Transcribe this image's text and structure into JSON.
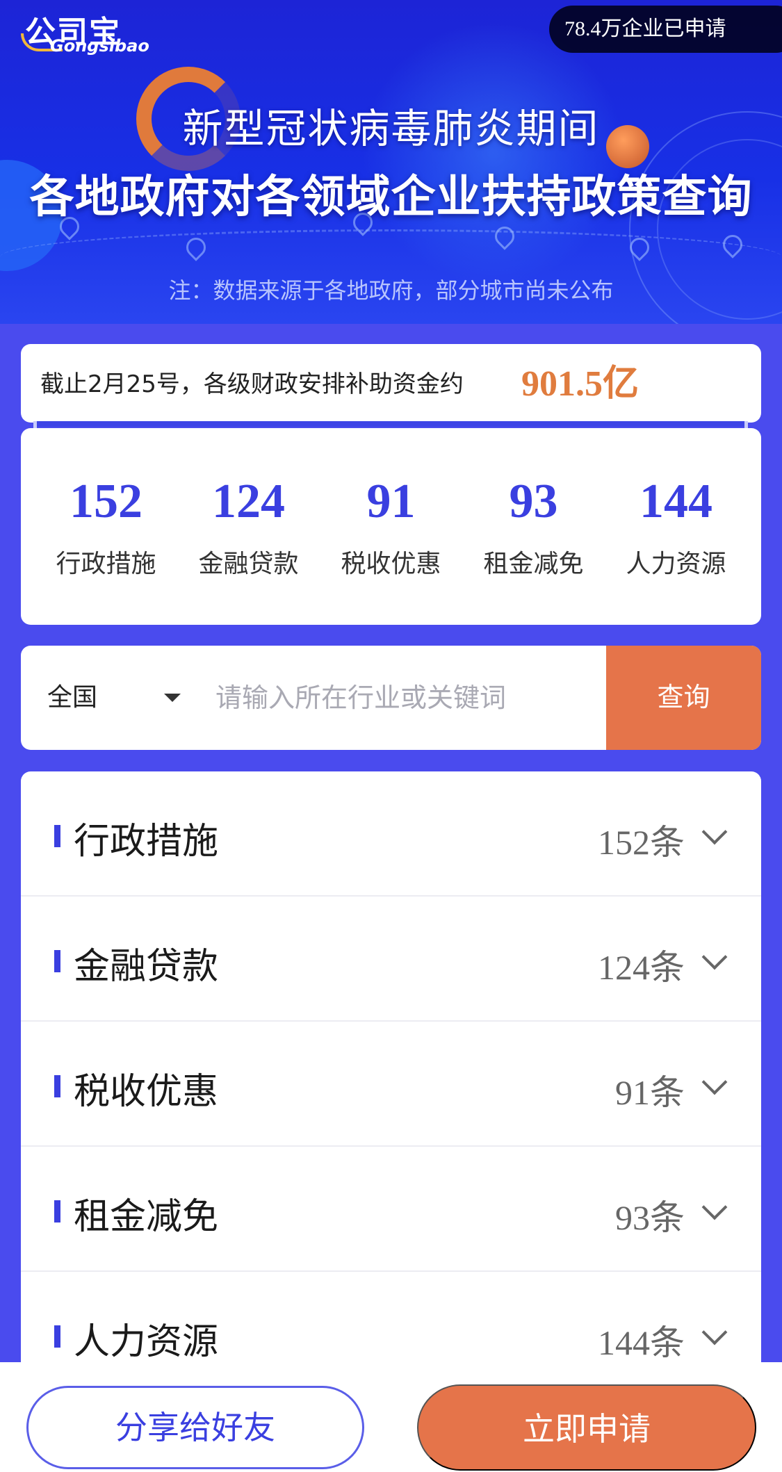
{
  "header": {
    "logo_cn": "公司宝",
    "logo_en": "Gongsibao",
    "applied_badge": "78.4万企业已申请",
    "title_line1": "新型冠状病毒肺炎期间",
    "title_line2": "各地政府对各领域企业扶持政策查询",
    "note": "注：数据来源于各地政府，部分城市尚未公布"
  },
  "funding": {
    "text": "截止2月25号，各级财政安排补助资金约",
    "amount": "901.5亿",
    "accent_color": "#e07c3e"
  },
  "stats": [
    {
      "value": "152",
      "label": "行政措施"
    },
    {
      "value": "124",
      "label": "金融贷款"
    },
    {
      "value": "91",
      "label": "税收优惠"
    },
    {
      "value": "93",
      "label": "租金减免"
    },
    {
      "value": "144",
      "label": "人力资源"
    }
  ],
  "search": {
    "region": "全国",
    "placeholder": "请输入所在行业或关键词",
    "button_label": "查询"
  },
  "categories": [
    {
      "name": "行政措施",
      "count": "152条"
    },
    {
      "name": "金融贷款",
      "count": "124条"
    },
    {
      "name": "税收优惠",
      "count": "91条"
    },
    {
      "name": "租金减免",
      "count": "93条"
    },
    {
      "name": "人力资源",
      "count": "144条"
    }
  ],
  "actions": {
    "share_label": "分享给好友",
    "apply_label": "立即申请"
  },
  "colors": {
    "brand_blue": "#3a3fe0",
    "page_background": "#4a4bee",
    "cta_orange": "#e5744a"
  },
  "icons": {
    "region_dropdown": "caret-down-icon",
    "category_expand": "chevron-down-icon",
    "map_marker": "map-pin-icon"
  }
}
